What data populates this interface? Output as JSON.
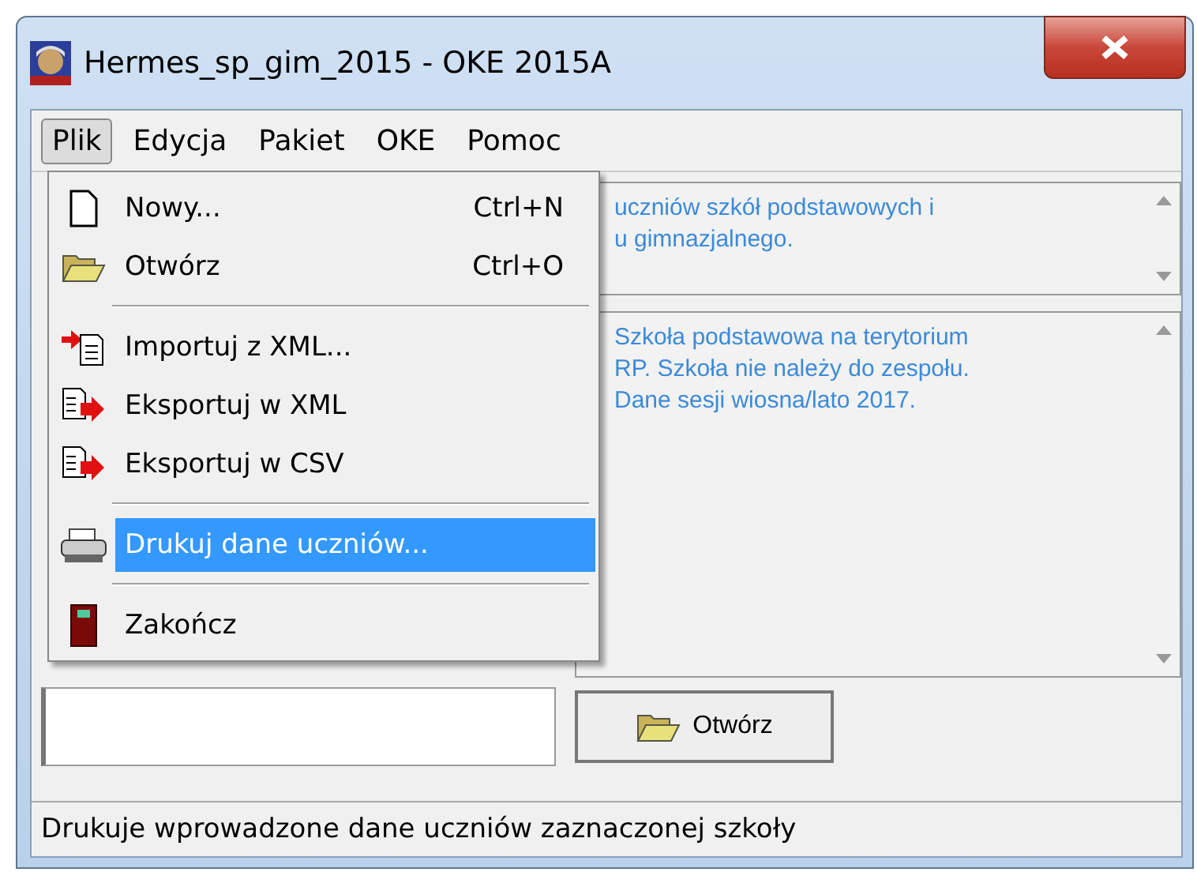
{
  "window": {
    "title": "Hermes_sp_gim_2015 - OKE 2015A"
  },
  "menu_bar": [
    {
      "label": "Plik",
      "selected": true
    },
    {
      "label": "Edycja",
      "selected": false
    },
    {
      "label": "Pakiet",
      "selected": false
    },
    {
      "label": "OKE",
      "selected": false
    },
    {
      "label": "Pomoc",
      "selected": false
    }
  ],
  "file_menu": [
    {
      "kind": "item",
      "label": "Nowy...",
      "shortcut": "Ctrl+N",
      "selected": false
    },
    {
      "kind": "item",
      "label": "Otwórz",
      "shortcut": "Ctrl+O",
      "selected": false
    },
    {
      "kind": "separator"
    },
    {
      "kind": "item",
      "label": "Importuj z XML...",
      "selected": false
    },
    {
      "kind": "item",
      "label": "Eksportuj w XML",
      "selected": false
    },
    {
      "kind": "item",
      "label": "Eksportuj w CSV",
      "selected": false
    },
    {
      "kind": "separator"
    },
    {
      "kind": "item",
      "label": "Drukuj dane uczniów...",
      "selected": true
    },
    {
      "kind": "separator"
    },
    {
      "kind": "item",
      "label": "Zakończ",
      "selected": false
    }
  ],
  "description_box": {
    "lines": [
      "uczniów szkół podstawowych i",
      "u gimnazjalnego."
    ]
  },
  "school_info_box": {
    "lines": [
      "Szkoła podstawowa na terytorium",
      "RP. Szkoła nie należy do zespołu.",
      "Dane sesji wiosna/lato 2017."
    ]
  },
  "open_button": {
    "label": "Otwórz"
  },
  "status_bar": {
    "text": "Drukuje wprowadzone dane uczniów zaznaczonej szkoły"
  }
}
